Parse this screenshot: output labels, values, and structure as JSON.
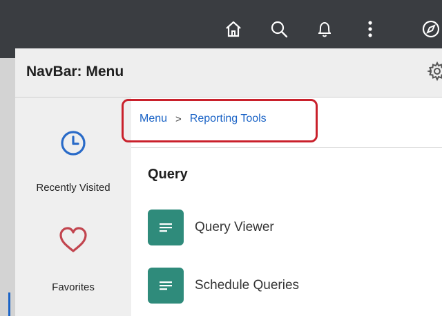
{
  "topbar": {
    "icons": [
      "home-icon",
      "search-icon",
      "notification-bell-icon",
      "actions-menu-icon",
      "navbar-icon"
    ],
    "background": "#3a3d41"
  },
  "panel": {
    "title": "NavBar: Menu",
    "settings_icon": "gear-icon"
  },
  "sidebar": {
    "items": [
      {
        "label": "Recently Visited",
        "icon": "clock-icon"
      },
      {
        "label": "Favorites",
        "icon": "heart-icon"
      }
    ]
  },
  "breadcrumb": {
    "items": [
      "Menu",
      "Reporting Tools"
    ],
    "separator": ">"
  },
  "content": {
    "section_title": "Query",
    "tiles": [
      {
        "label": "Query Viewer",
        "icon": "document-lines-icon"
      },
      {
        "label": "Schedule Queries",
        "icon": "document-lines-icon"
      }
    ]
  },
  "colors": {
    "link": "#1a63c6",
    "tile_icon": "#2f8b7b",
    "highlight": "#c9202b",
    "clock": "#2a6bc8",
    "heart": "#c2454f"
  }
}
